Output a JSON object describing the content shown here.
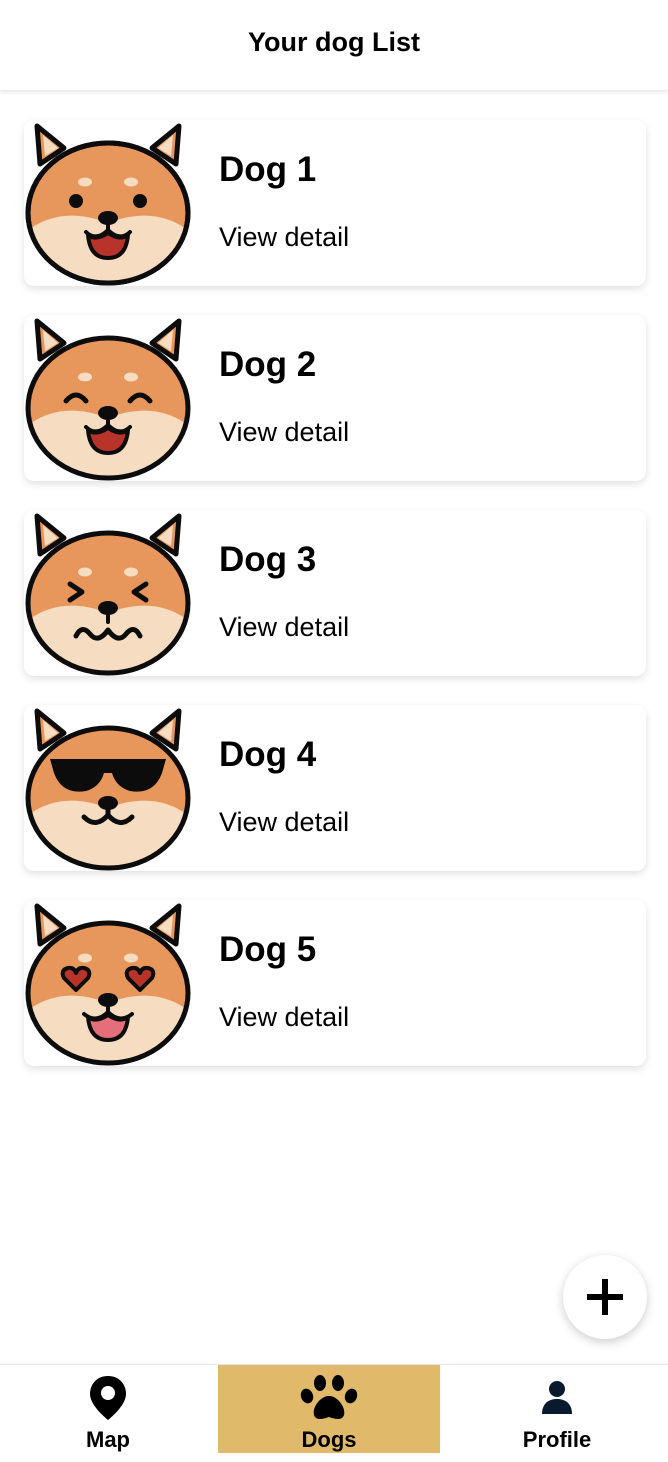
{
  "header": {
    "title": "Your dog List"
  },
  "dogs": [
    {
      "name": "Dog 1",
      "link": "View detail",
      "expression": "happy"
    },
    {
      "name": "Dog 2",
      "link": "View detail",
      "expression": "smiling-closed-eyes"
    },
    {
      "name": "Dog 3",
      "link": "View detail",
      "expression": "squinting"
    },
    {
      "name": "Dog 4",
      "link": "View detail",
      "expression": "sunglasses"
    },
    {
      "name": "Dog 5",
      "link": "View detail",
      "expression": "heart-eyes"
    }
  ],
  "fab": {
    "icon": "plus-icon"
  },
  "tabbar": {
    "active": "dogs",
    "active_color": "#e0b96b",
    "tabs": [
      {
        "id": "map",
        "label": "Map",
        "icon": "map-pin-icon"
      },
      {
        "id": "dogs",
        "label": "Dogs",
        "icon": "paw-icon"
      },
      {
        "id": "profile",
        "label": "Profile",
        "icon": "person-icon"
      }
    ]
  },
  "colors": {
    "fur": "#e8975c",
    "cream": "#f6dcc0",
    "outline": "#0c0c0c",
    "tongue": "#b8342a"
  }
}
